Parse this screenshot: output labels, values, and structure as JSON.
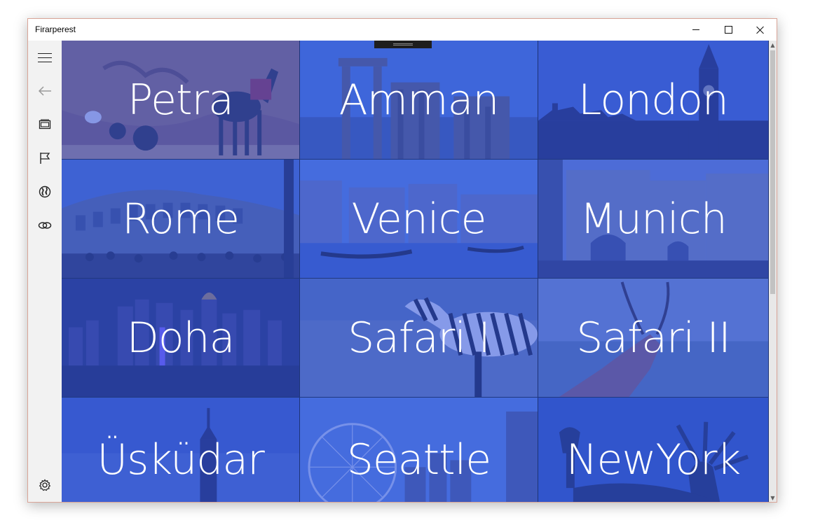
{
  "window": {
    "title": "Firarperest",
    "controls": [
      "minimize-icon",
      "maximize-icon",
      "close-icon"
    ]
  },
  "sidebar": {
    "items": [
      {
        "icon": "hamburger-menu-icon"
      },
      {
        "icon": "back-arrow-icon"
      },
      {
        "icon": "gallery-icon"
      },
      {
        "icon": "flag-icon"
      },
      {
        "icon": "globe-icon"
      },
      {
        "icon": "link-icon"
      },
      {
        "icon": "settings-icon"
      }
    ]
  },
  "tiles": [
    {
      "label": "Petra",
      "scene": "rock-desert-donkey"
    },
    {
      "label": "Amman",
      "scene": "ancient-columns"
    },
    {
      "label": "London",
      "scene": "big-ben-parliament"
    },
    {
      "label": "Rome",
      "scene": "colosseum"
    },
    {
      "label": "Venice",
      "scene": "canal-gondolas"
    },
    {
      "label": "Munich",
      "scene": "city-gate-crowd"
    },
    {
      "label": "Doha",
      "scene": "night-skyline"
    },
    {
      "label": "Safari I",
      "scene": "zebra"
    },
    {
      "label": "Safari II",
      "scene": "antelope"
    },
    {
      "label": "Üsküdar",
      "scene": "tower-dusk"
    },
    {
      "label": "Seattle",
      "scene": "ferris-wheel"
    },
    {
      "label": "NewYork",
      "scene": "statue-of-liberty"
    }
  ],
  "colors": {
    "overlay": "#3458dc",
    "window_border": "#d9a497",
    "sidebar_bg": "#f2f2f2"
  }
}
